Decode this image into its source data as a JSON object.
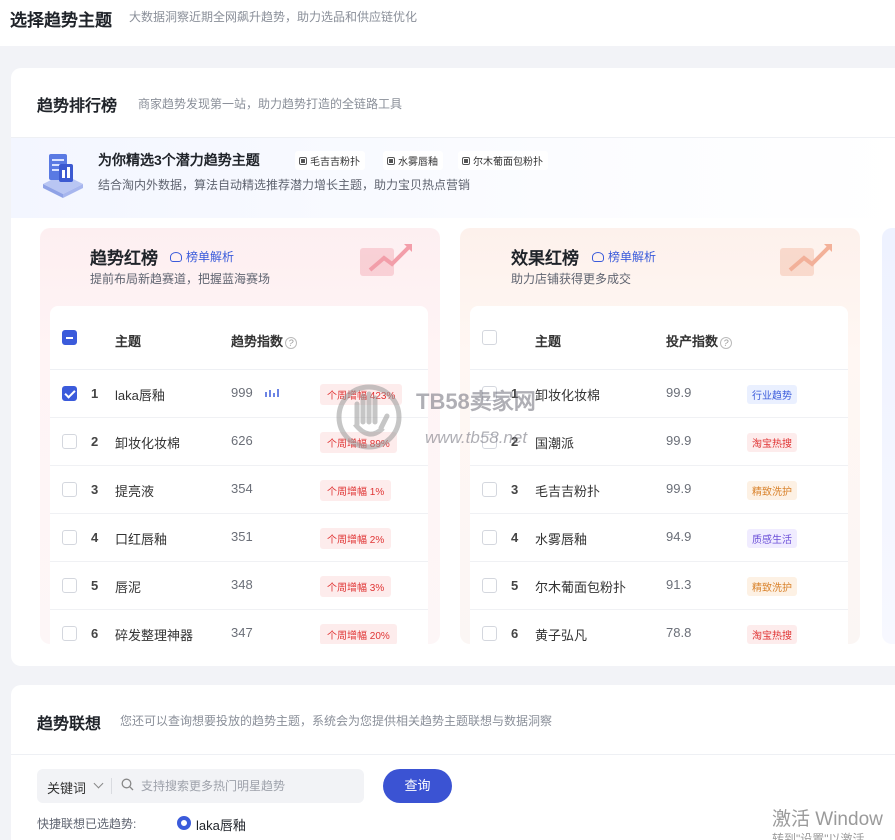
{
  "page": {
    "title": "选择趋势主题",
    "subtitle": "大数据洞察近期全网飙升趋势，助力选品和供应链优化"
  },
  "ranking": {
    "title": "趋势排行榜",
    "subtitle": "商家趋势发现第一站，助力趋势打造的全链路工具",
    "picks": {
      "title": "为你精选3个潜力趋势主题",
      "desc": "结合淘内外数据，算法自动精选推荐潜力增长主题，助力宝贝热点营销",
      "tags": [
        "毛吉吉粉扑",
        "水雾唇釉",
        "尔木葡面包粉扑"
      ]
    },
    "trend_board": {
      "title": "趋势红榜",
      "analysis": "榜单解析",
      "subtitle": "提前布局新趋赛道，把握蓝海赛场",
      "col_topic": "主题",
      "col_index": "趋势指数",
      "rows": [
        {
          "rank": "1",
          "name": "laka唇釉",
          "value": "999",
          "badge": "个周增幅 423%",
          "checked": true
        },
        {
          "rank": "2",
          "name": "卸妆化妆棉",
          "value": "626",
          "badge": "个周增幅 89%",
          "checked": false
        },
        {
          "rank": "3",
          "name": "提亮液",
          "value": "354",
          "badge": "个周增幅 1%",
          "checked": false
        },
        {
          "rank": "4",
          "name": "口红唇釉",
          "value": "351",
          "badge": "个周增幅 2%",
          "checked": false
        },
        {
          "rank": "5",
          "name": "唇泥",
          "value": "348",
          "badge": "个周增幅 3%",
          "checked": false
        },
        {
          "rank": "6",
          "name": "碎发整理神器",
          "value": "347",
          "badge": "个周增幅 20%",
          "checked": false
        }
      ]
    },
    "effect_board": {
      "title": "效果红榜",
      "analysis": "榜单解析",
      "subtitle": "助力店铺获得更多成交",
      "col_topic": "主题",
      "col_index": "投产指数",
      "rows": [
        {
          "rank": "1",
          "name": "卸妆化妆棉",
          "value": "99.9",
          "tag": "行业趋势",
          "tag_class": "t-blue"
        },
        {
          "rank": "2",
          "name": "国潮派",
          "value": "99.9",
          "tag": "淘宝热搜",
          "tag_class": "t-red"
        },
        {
          "rank": "3",
          "name": "毛吉吉粉扑",
          "value": "99.9",
          "tag": "精致洗护",
          "tag_class": "t-orange"
        },
        {
          "rank": "4",
          "name": "水雾唇釉",
          "value": "94.9",
          "tag": "质感生活",
          "tag_class": "t-purple"
        },
        {
          "rank": "5",
          "name": "尔木葡面包粉扑",
          "value": "91.3",
          "tag": "精致洗护",
          "tag_class": "t-orange"
        },
        {
          "rank": "6",
          "name": "黄子弘凡",
          "value": "78.8",
          "tag": "淘宝热搜",
          "tag_class": "t-red"
        }
      ]
    }
  },
  "association": {
    "title": "趋势联想",
    "subtitle": "您还可以查询想要投放的趋势主题，系统会为您提供相关趋势主题联想与数据洞察",
    "select_label": "关键词",
    "search_placeholder": "支持搜索更多热门明星趋势",
    "query_button": "查询",
    "quick_label": "快捷联想已选趋势:",
    "quick_value": "laka唇釉"
  },
  "watermark": {
    "brand": "TB58卖家网",
    "url": "www.tb58.net"
  },
  "os_overlay": {
    "line1": "激活 Window",
    "line2": "转到\"设置\"以激活"
  }
}
